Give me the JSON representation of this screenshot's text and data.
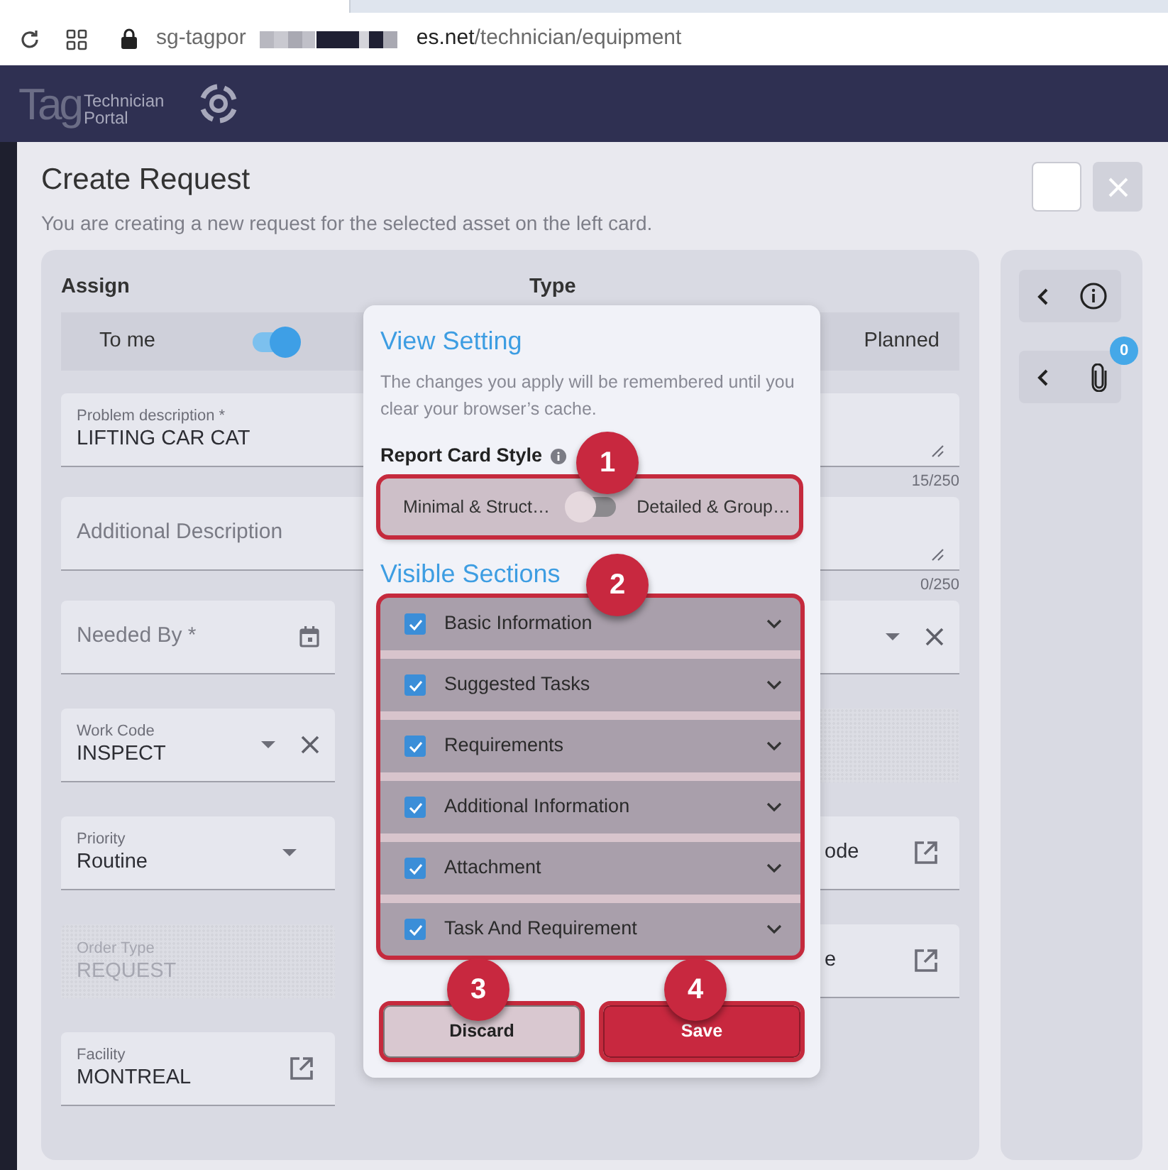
{
  "browser": {
    "url_host": "sg-tagpor",
    "url_host_tail": "es.net",
    "url_path": "/technician/equipment"
  },
  "navbar": {
    "logo_mark": "Tag",
    "logo_line_1": "Technician",
    "logo_line_2": "Portal"
  },
  "header": {
    "title": "Create Request",
    "subtitle": "You are creating a new request for the selected asset on the left card."
  },
  "form": {
    "assign": {
      "label": "Assign",
      "option": "To me",
      "on": true
    },
    "type": {
      "label": "Type",
      "option": "Planned"
    },
    "wide_fields": [
      {
        "kind": "textarea",
        "label": "Problem description *",
        "value": "LIFTING CAR CAT",
        "counter": "15/250"
      },
      {
        "kind": "textarea",
        "placeholder": "Additional Description",
        "counter": "0/250"
      }
    ],
    "left_fields": [
      {
        "kind": "date",
        "placeholder": "Needed By *"
      },
      {
        "kind": "select",
        "label": "Work Code",
        "value": "INSPECT",
        "clearable": true
      },
      {
        "kind": "select",
        "label": "Priority",
        "value": "Routine",
        "clearable": false
      },
      {
        "kind": "disabled",
        "label": "Order Type",
        "value": "REQUEST"
      },
      {
        "kind": "link",
        "label": "Facility",
        "value": "MONTREAL"
      }
    ],
    "right_fields": [
      {
        "kind": "select",
        "clearable": true
      },
      {
        "kind": "disabled"
      },
      {
        "kind": "link",
        "value": "ode"
      },
      {
        "kind": "link",
        "value": "e"
      }
    ]
  },
  "side_panel": {
    "attachment_count": "0"
  },
  "view_setting": {
    "title": "View Setting",
    "description": "The changes you apply will be remembered until you clear your browser’s cache.",
    "card_style": {
      "label": "Report Card Style",
      "left_option": "Minimal & Struct…",
      "right_option": "Detailed & Group…",
      "on": false
    },
    "sections_title": "Visible Sections",
    "sections": [
      {
        "label": "Basic Information",
        "checked": true
      },
      {
        "label": "Suggested Tasks",
        "checked": true
      },
      {
        "label": "Requirements",
        "checked": true
      },
      {
        "label": "Additional Information",
        "checked": true
      },
      {
        "label": "Attachment",
        "checked": true
      },
      {
        "label": "Task And Requirement",
        "checked": true
      }
    ],
    "buttons": [
      {
        "kind": "secondary",
        "label": "Discard"
      },
      {
        "kind": "primary",
        "label": "Save"
      }
    ]
  },
  "callouts": [
    {
      "number": "1"
    },
    {
      "number": "2"
    },
    {
      "number": "3"
    },
    {
      "number": "4"
    }
  ]
}
